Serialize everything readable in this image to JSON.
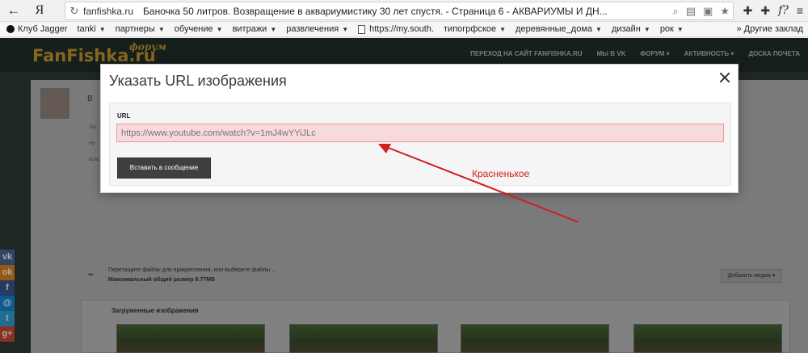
{
  "browser": {
    "back_icon": "back-arrow-icon",
    "logo": "Я",
    "reload_icon": "reload-icon",
    "domain": "fanfishka.ru",
    "title": "Баночка 50 литров. Возвращение в аквариумистику 30 лет спустя. - Страница 6 - АКВАРИУМЫ И ДН...",
    "f_button": "f?"
  },
  "bookmarks": {
    "items": [
      {
        "label": "Клуб Jagger",
        "dropdown": false,
        "icon": true
      },
      {
        "label": "tanki",
        "dropdown": true
      },
      {
        "label": "партнеры",
        "dropdown": true
      },
      {
        "label": "обучение",
        "dropdown": true
      },
      {
        "label": "витражи",
        "dropdown": true
      },
      {
        "label": "развлечения",
        "dropdown": true
      },
      {
        "label": "https://my.south.",
        "dropdown": false,
        "page": true
      },
      {
        "label": "типогрфское",
        "dropdown": true
      },
      {
        "label": "деревянные_дома",
        "dropdown": true
      },
      {
        "label": "дизайн",
        "dropdown": true
      },
      {
        "label": "рок",
        "dropdown": true
      }
    ],
    "other": "Другие заклад"
  },
  "site": {
    "logo": "FanFishka.ru",
    "forum_tag": "форум",
    "nav": [
      "ПЕРЕХОД НА САЙТ FANFISHKA.RU",
      "МЫ В VK",
      "ФОРУМ ▾",
      "АКТИВНОСТЬ ▾",
      "ДОСКА ПОЧЕТА"
    ],
    "post_letter": "В",
    "side_texts": [
      "Тес",
      "Ну",
      "кста"
    ],
    "attach_line": "Перетащите файлы для прикрепления, или выберите файлы ...",
    "max_size": "Максимальный общий размер 9.77MB",
    "add_media": "Добавить медиа ▾",
    "uploads_title": "Загруженные изображения",
    "social": [
      "vk",
      "ok",
      "f",
      "@",
      "tw",
      "g+"
    ]
  },
  "modal": {
    "title": "Указать URL изображения",
    "url_label": "URL",
    "url_placeholder": "https://www.youtube.com/watch?v=1mJ4wYYiJLc",
    "insert_button": "Вставить в сообщение"
  },
  "annotation": {
    "text": "Красненькое",
    "color": "#d21e1e"
  },
  "colors": {
    "input_bg": "#f8d9dc",
    "input_border": "#e89aa2",
    "button_bg": "#3f3f3f",
    "site_bg": "#2f3d37",
    "logo": "#c9a033"
  }
}
